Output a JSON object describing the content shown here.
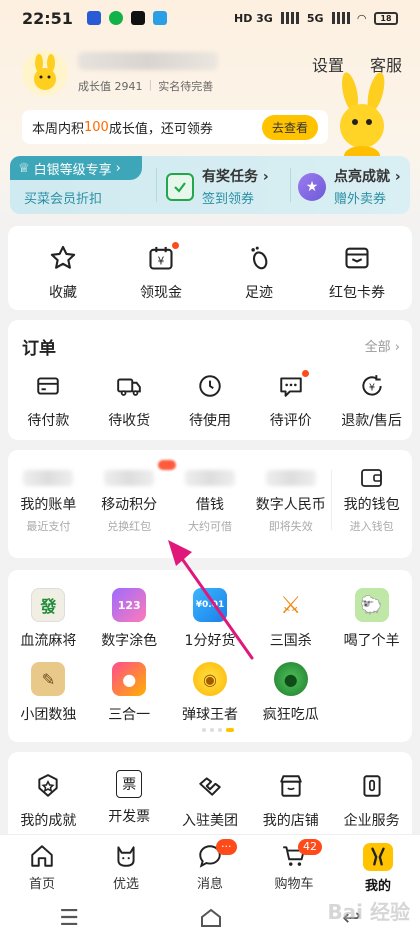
{
  "status_bar": {
    "time": "22:51",
    "network1": "HD 3G",
    "network2": "5G",
    "battery": "18"
  },
  "profile": {
    "growth": "成长值 2941",
    "realname": "实名待完善"
  },
  "top_links": {
    "settings": "设置",
    "service": "客服"
  },
  "promo": {
    "prefix": "本周内积",
    "highlight": "100",
    "suffix": "成长值，还可领券",
    "button": "去查看"
  },
  "member": {
    "tag": "白银等级专享",
    "sub": "买菜会员折扣",
    "items": [
      {
        "title": "有奖任务",
        "sub": "签到领券"
      },
      {
        "title": "点亮成就",
        "sub": "赠外卖券"
      }
    ]
  },
  "quick": [
    {
      "label": "收藏",
      "icon": "star-icon"
    },
    {
      "label": "领现金",
      "icon": "calendar-cash-icon"
    },
    {
      "label": "足迹",
      "icon": "footprint-icon"
    },
    {
      "label": "红包卡券",
      "icon": "wallet-card-icon"
    }
  ],
  "orders": {
    "title": "订单",
    "more": "全部",
    "items": [
      {
        "label": "待付款",
        "icon": "card-icon"
      },
      {
        "label": "待收货",
        "icon": "truck-icon"
      },
      {
        "label": "待使用",
        "icon": "clock-icon"
      },
      {
        "label": "待评价",
        "icon": "comment-icon"
      },
      {
        "label": "退款/售后",
        "icon": "refund-icon"
      }
    ]
  },
  "finance": [
    {
      "label": "我的账单",
      "sub": "最近支付"
    },
    {
      "label": "移动积分",
      "sub": "兑换红包"
    },
    {
      "label": "借钱",
      "sub": "大约可借"
    },
    {
      "label": "数字人民币",
      "sub": "即将失效"
    },
    {
      "label": "我的钱包",
      "sub": "进入钱包"
    }
  ],
  "games": [
    {
      "label": "血流麻将",
      "glyph": "發"
    },
    {
      "label": "数字涂色",
      "glyph": "123"
    },
    {
      "label": "1分好货",
      "glyph": "¥0.01"
    },
    {
      "label": "三国杀",
      "glyph": "⚔"
    },
    {
      "label": "喝了个羊",
      "glyph": "🐑"
    },
    {
      "label": "小团数独",
      "glyph": "✎"
    },
    {
      "label": "三合一",
      "glyph": "●"
    },
    {
      "label": "弹球王者",
      "glyph": "◉"
    },
    {
      "label": "疯狂吃瓜",
      "glyph": "●"
    }
  ],
  "services": [
    {
      "label": "我的成就",
      "icon": "achievement-icon"
    },
    {
      "label": "开发票",
      "icon": "invoice-icon",
      "glyph": "票"
    },
    {
      "label": "入驻美团",
      "icon": "handshake-icon"
    },
    {
      "label": "我的店铺",
      "icon": "store-icon"
    },
    {
      "label": "企业服务",
      "icon": "enterprise-icon"
    }
  ],
  "tabs": [
    {
      "label": "首页",
      "icon": "home-icon"
    },
    {
      "label": "优选",
      "icon": "youxuan-icon"
    },
    {
      "label": "消息",
      "icon": "message-icon",
      "badge": "···"
    },
    {
      "label": "购物车",
      "icon": "cart-icon",
      "badge": "42"
    },
    {
      "label": "我的",
      "icon": "mine-icon"
    }
  ],
  "watermark": "Bai 经验",
  "colors": {
    "brand_yellow": "#ffc300",
    "accent_orange": "#ff6a00",
    "member_teal": "#3da7b9",
    "arrow_magenta": "#e0187a"
  }
}
